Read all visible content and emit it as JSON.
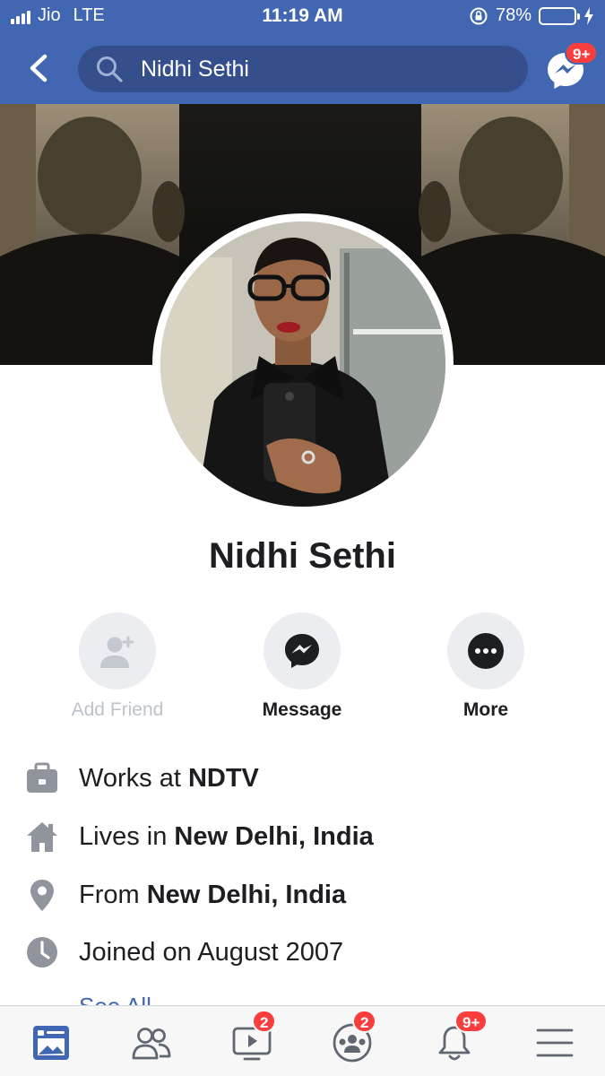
{
  "status_bar": {
    "carrier": "Jio",
    "network": "LTE",
    "time": "11:19 AM",
    "battery": "78%",
    "battery_level": 0.78
  },
  "search": {
    "value": "Nidhi Sethi"
  },
  "messenger": {
    "badge": "9+"
  },
  "profile": {
    "name": "Nidhi Sethi"
  },
  "actions": [
    {
      "label": "Add Friend",
      "icon": "add-friend-icon",
      "enabled": false
    },
    {
      "label": "Message",
      "icon": "messenger-icon",
      "enabled": true
    },
    {
      "label": "More",
      "icon": "more-icon",
      "enabled": true
    }
  ],
  "info": [
    {
      "icon": "briefcase-icon",
      "prefix": "Works at",
      "value": "NDTV"
    },
    {
      "icon": "home-icon",
      "prefix": "Lives in",
      "value": "New Delhi, India"
    },
    {
      "icon": "location-pin-icon",
      "prefix": "From",
      "value": "New Delhi, India"
    },
    {
      "icon": "clock-icon",
      "prefix": "Joined on August 2007",
      "value": ""
    }
  ],
  "see_all": "See All",
  "tabs": [
    {
      "icon": "news-feed-icon",
      "badge": "",
      "active": true
    },
    {
      "icon": "friends-icon",
      "badge": "",
      "active": false
    },
    {
      "icon": "watch-icon",
      "badge": "2",
      "active": false
    },
    {
      "icon": "groups-icon",
      "badge": "2",
      "active": false
    },
    {
      "icon": "notifications-icon",
      "badge": "9+",
      "active": false
    },
    {
      "icon": "menu-icon",
      "badge": "",
      "active": false
    }
  ],
  "colors": {
    "brand": "#4267b2",
    "badge": "#fa3e3e",
    "icon_gray": "#90949c"
  }
}
